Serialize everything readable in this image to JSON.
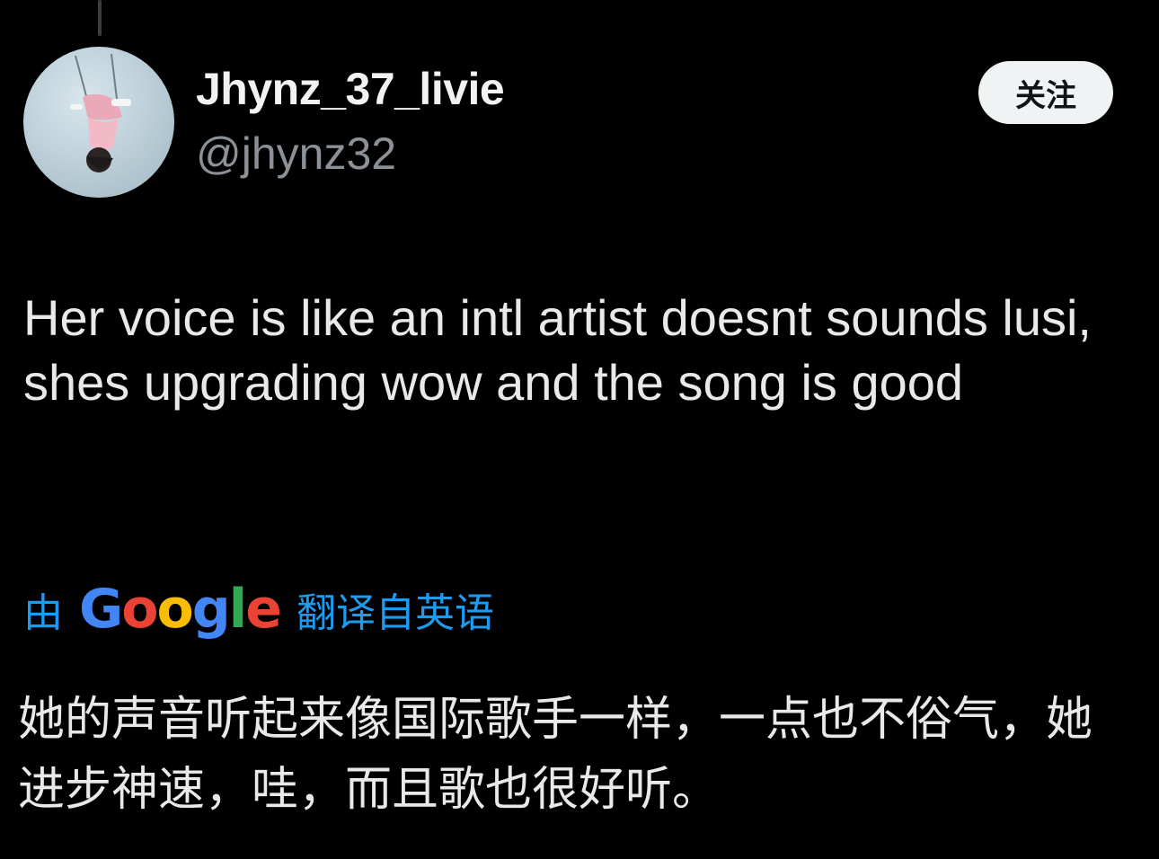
{
  "author": {
    "display_name": "Jhynz_37_livie",
    "handle": "@jhynz32"
  },
  "follow_label": "关注",
  "tweet": {
    "text": "Her voice is like an intl artist doesnt sounds lusi, shes upgrading wow and the song is good"
  },
  "translation": {
    "prefix": "由",
    "logo_letters": [
      "G",
      "o",
      "o",
      "g",
      "l",
      "e"
    ],
    "suffix": "翻译自英语",
    "text": "她的声音听起来像国际歌手一样，一点也不俗气，她进步神速，哇，而且歌也很好听。"
  },
  "colors": {
    "background": "#000000",
    "accent": "#1d9bf0",
    "google_blue": "#4285f4",
    "google_red": "#ea4335",
    "google_yellow": "#fbbc05",
    "google_green": "#34a853"
  }
}
